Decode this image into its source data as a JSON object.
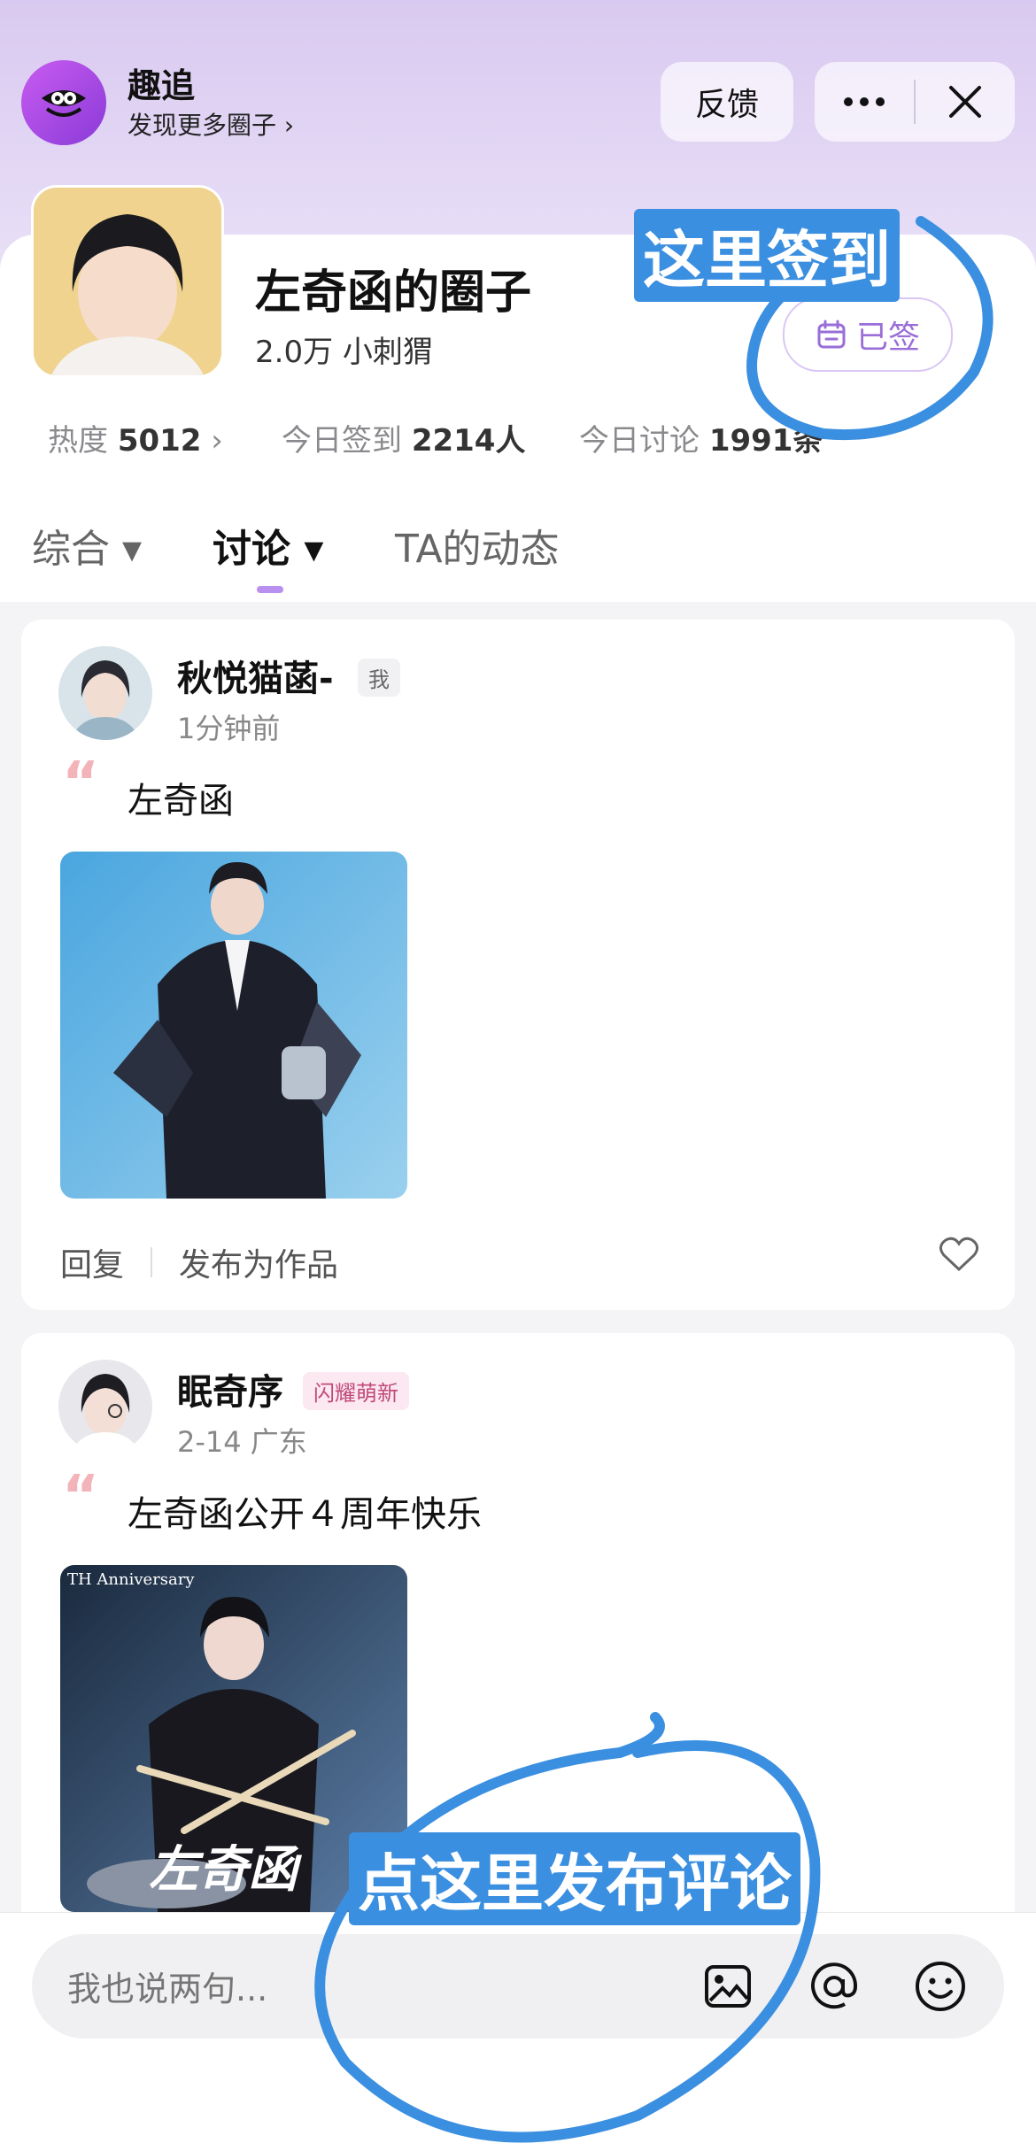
{
  "header": {
    "app_name": "趣追",
    "app_sub": "发现更多圈子 ›",
    "feedback_label": "反馈",
    "more_icon": "more-horizontal-icon",
    "close_icon": "close-icon"
  },
  "circle": {
    "name": "左奇函的圈子",
    "meta": "2.0万 小刺猬",
    "signed_label": "已签",
    "stats": {
      "heat_label": "热度",
      "heat_value": "5012",
      "heat_arrow": "›",
      "signin_label": "今日签到",
      "signin_value": "2214人",
      "discuss_label": "今日讨论",
      "discuss_value": "1991条"
    }
  },
  "tabs": [
    {
      "label": "综合 ▾"
    },
    {
      "label": "讨论 ▾"
    },
    {
      "label": "TA的动态"
    }
  ],
  "posts": [
    {
      "name": "秋悦猫菡-",
      "badge": "我",
      "time": "1分钟前",
      "text": "左奇函",
      "reply": "回复",
      "publish": "发布为作品"
    },
    {
      "name": "眠奇序",
      "badge": "闪耀萌新",
      "time": "2-14 广东",
      "text": "左奇函公开４周年快乐",
      "img_caption": "左奇函",
      "img_corner": "TH Anniversary"
    }
  ],
  "composer": {
    "placeholder": "我也说两句..."
  },
  "annotations": {
    "sign_here": "这里签到",
    "comment_here": "点这里发布评论"
  },
  "colors": {
    "accent": "#b98ff0",
    "annotation": "#3b8fe0"
  }
}
